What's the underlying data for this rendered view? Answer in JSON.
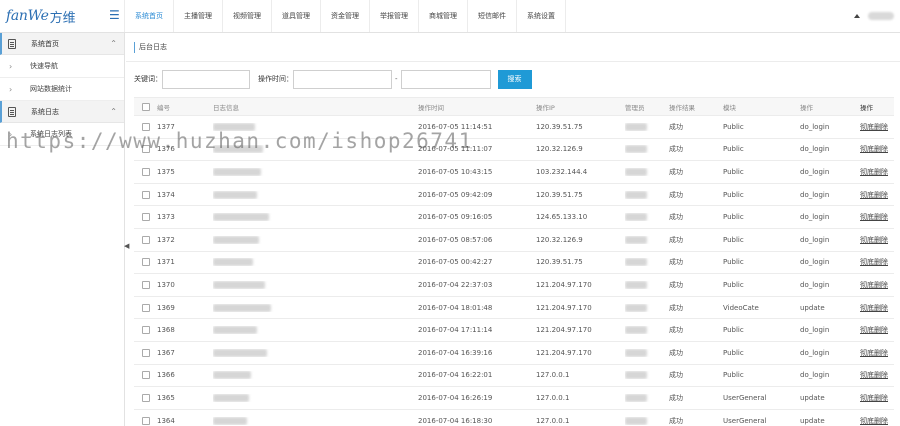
{
  "brand": {
    "latin": "fanWe",
    "cn": "方维"
  },
  "nav": [
    "系统首页",
    "主播管理",
    "视频管理",
    "道具管理",
    "资金管理",
    "举报管理",
    "商城管理",
    "短信邮件",
    "系统设置"
  ],
  "sidebar": {
    "groups": [
      {
        "label": "系统首页",
        "items": [
          "快速导航",
          "网站数据统计"
        ]
      },
      {
        "label": "系统日志",
        "items": [
          "系统日志列表"
        ]
      }
    ]
  },
  "breadcrumb": "后台日志",
  "search": {
    "keyword_label": "关键词：",
    "time_label": "操作时间：",
    "separator": "-",
    "button": "搜索"
  },
  "table": {
    "headers": [
      "编号",
      "日志信息",
      "操作时间",
      "操作IP",
      "管理员",
      "操作结果",
      "模块",
      "操作",
      "操作"
    ],
    "rows": [
      {
        "id": "1377",
        "time": "2016-07-05 11:14:51",
        "ip": "120.39.51.75",
        "status": "成功",
        "module": "Public",
        "action": "do_login",
        "op": "彻底删除"
      },
      {
        "id": "1376",
        "time": "2016-07-05 11:11:07",
        "ip": "120.32.126.9",
        "status": "成功",
        "module": "Public",
        "action": "do_login",
        "op": "彻底删除"
      },
      {
        "id": "1375",
        "time": "2016-07-05 10:43:15",
        "ip": "103.232.144.4",
        "status": "成功",
        "module": "Public",
        "action": "do_login",
        "op": "彻底删除"
      },
      {
        "id": "1374",
        "time": "2016-07-05 09:42:09",
        "ip": "120.39.51.75",
        "status": "成功",
        "module": "Public",
        "action": "do_login",
        "op": "彻底删除"
      },
      {
        "id": "1373",
        "time": "2016-07-05 09:16:05",
        "ip": "124.65.133.10",
        "status": "成功",
        "module": "Public",
        "action": "do_login",
        "op": "彻底删除"
      },
      {
        "id": "1372",
        "time": "2016-07-05 08:57:06",
        "ip": "120.32.126.9",
        "status": "成功",
        "module": "Public",
        "action": "do_login",
        "op": "彻底删除"
      },
      {
        "id": "1371",
        "time": "2016-07-05 00:42:27",
        "ip": "120.39.51.75",
        "status": "成功",
        "module": "Public",
        "action": "do_login",
        "op": "彻底删除"
      },
      {
        "id": "1370",
        "time": "2016-07-04 22:37:03",
        "ip": "121.204.97.170",
        "status": "成功",
        "module": "Public",
        "action": "do_login",
        "op": "彻底删除"
      },
      {
        "id": "1369",
        "time": "2016-07-04 18:01:48",
        "ip": "121.204.97.170",
        "status": "成功",
        "module": "VideoCate",
        "action": "update",
        "op": "彻底删除"
      },
      {
        "id": "1368",
        "time": "2016-07-04 17:11:14",
        "ip": "121.204.97.170",
        "status": "成功",
        "module": "Public",
        "action": "do_login",
        "op": "彻底删除"
      },
      {
        "id": "1367",
        "time": "2016-07-04 16:39:16",
        "ip": "121.204.97.170",
        "status": "成功",
        "module": "Public",
        "action": "do_login",
        "op": "彻底删除"
      },
      {
        "id": "1366",
        "time": "2016-07-04 16:22:01",
        "ip": "127.0.0.1",
        "status": "成功",
        "module": "Public",
        "action": "do_login",
        "op": "彻底删除"
      },
      {
        "id": "1365",
        "time": "2016-07-04 16:26:19",
        "ip": "127.0.0.1",
        "status": "成功",
        "module": "UserGeneral",
        "action": "update",
        "op": "彻底删除"
      },
      {
        "id": "1364",
        "time": "2016-07-04 16:18:30",
        "ip": "127.0.0.1",
        "status": "成功",
        "module": "UserGeneral",
        "action": "update",
        "op": "彻底删除"
      }
    ]
  },
  "watermark": "https://www.huzhan.com/ishop26741",
  "icons": {
    "menu": "hamburger-icon",
    "user_caret": "caret-up-icon",
    "group_doc": "document-icon",
    "group_collapse": "chevron-up-icon",
    "item_expand": "chevron-right-icon",
    "sidebar_toggle": "collapse-left-icon"
  },
  "colors": {
    "brand": "#2c6fb3",
    "accent": "#1f9ad6",
    "active_nav": "#2a8ad4"
  }
}
